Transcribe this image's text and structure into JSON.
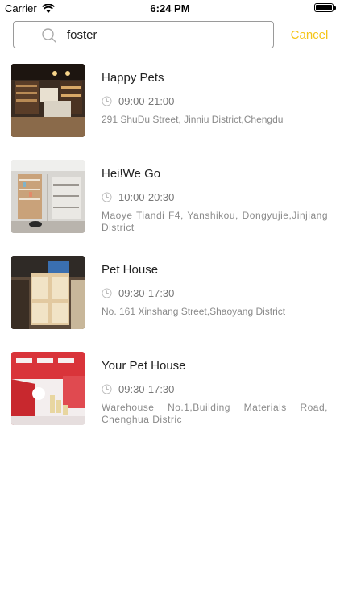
{
  "status_bar": {
    "carrier": "Carrier",
    "time": "6:24 PM",
    "icons": [
      "wifi-icon",
      "battery-icon"
    ]
  },
  "search": {
    "value": "foster",
    "placeholder": "",
    "cancel_label": "Cancel",
    "accent_color": "#f5c518"
  },
  "results": [
    {
      "name": "Happy Pets",
      "hours": "09:00-21:00",
      "address": "291 ShuDu Street, Jinniu District,Chengdu"
    },
    {
      "name": "Hei!We Go",
      "hours": "10:00-20:30",
      "address": "Maoye Tiandi F4, Yanshikou, Dongyujie,Jinjiang District"
    },
    {
      "name": "Pet House",
      "hours": "09:30-17:30",
      "address": "No. 161 Xinshang Street,Shaoyang District"
    },
    {
      "name": "Your Pet House",
      "hours": "09:30-17:30",
      "address": "Warehouse No.1,Building Materials Road, Chenghua Distric"
    }
  ]
}
